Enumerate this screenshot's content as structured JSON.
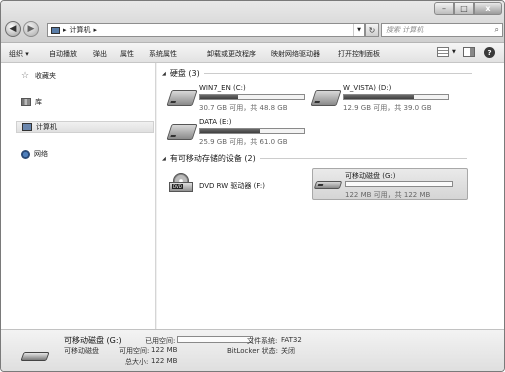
{
  "window": {
    "controls": {
      "minimize": "–",
      "maximize": "□",
      "close": "x"
    }
  },
  "address": {
    "crumb_sep": "▸",
    "location": "计算机",
    "search_placeholder": "搜索 计算机"
  },
  "toolbar": {
    "items": [
      "组织 ▾",
      "自动播放",
      "弹出",
      "属性",
      "系统属性",
      "卸载或更改程序",
      "映射网络驱动器",
      "打开控制面板"
    ]
  },
  "sidebar": {
    "items": [
      {
        "label": "收藏夹",
        "icon": "star-icon"
      },
      {
        "label": "库",
        "icon": "library-icon"
      },
      {
        "label": "计算机",
        "icon": "computer-icon",
        "selected": true
      },
      {
        "label": "网络",
        "icon": "network-icon"
      }
    ]
  },
  "groups": {
    "hard_disks": "硬盘 (3)",
    "removable": "有可移动存储的设备 (2)"
  },
  "drives": [
    {
      "name": "WIN7_EN (C:)",
      "free": "30.7 GB 可用，共 48.8 GB",
      "used_fraction": 0.37,
      "icon": "hard-drive-icon"
    },
    {
      "name": "W_VISTA) (D:)",
      "free": "12.9 GB 可用，共 39.0 GB",
      "used_fraction": 0.67,
      "icon": "hard-drive-icon"
    },
    {
      "name": "DATA (E:)",
      "free": "25.9 GB 可用，共 61.0 GB",
      "used_fraction": 0.58,
      "icon": "hard-drive-icon"
    }
  ],
  "removable": [
    {
      "name": "DVD RW 驱动器 (F:)",
      "icon": "dvd-drive-icon",
      "icon_text": "DVD"
    },
    {
      "name": "可移动磁盘 (G:)",
      "free": "122 MB 可用，共 122 MB",
      "used_fraction": 0.0,
      "icon": "removable-disk-icon",
      "selected": true
    }
  ],
  "details": {
    "title": "可移动磁盘 (G:)",
    "subtitle": "可移动磁盘",
    "used_label": "已用空间:",
    "free_label": "可用空间:",
    "free_value": "122 MB",
    "total_label": "总大小:",
    "total_value": "122 MB",
    "fs_label": "文件系统:",
    "fs_value": "FAT32",
    "bitlocker_label": "BitLocker 状态:",
    "bitlocker_value": "关闭"
  }
}
